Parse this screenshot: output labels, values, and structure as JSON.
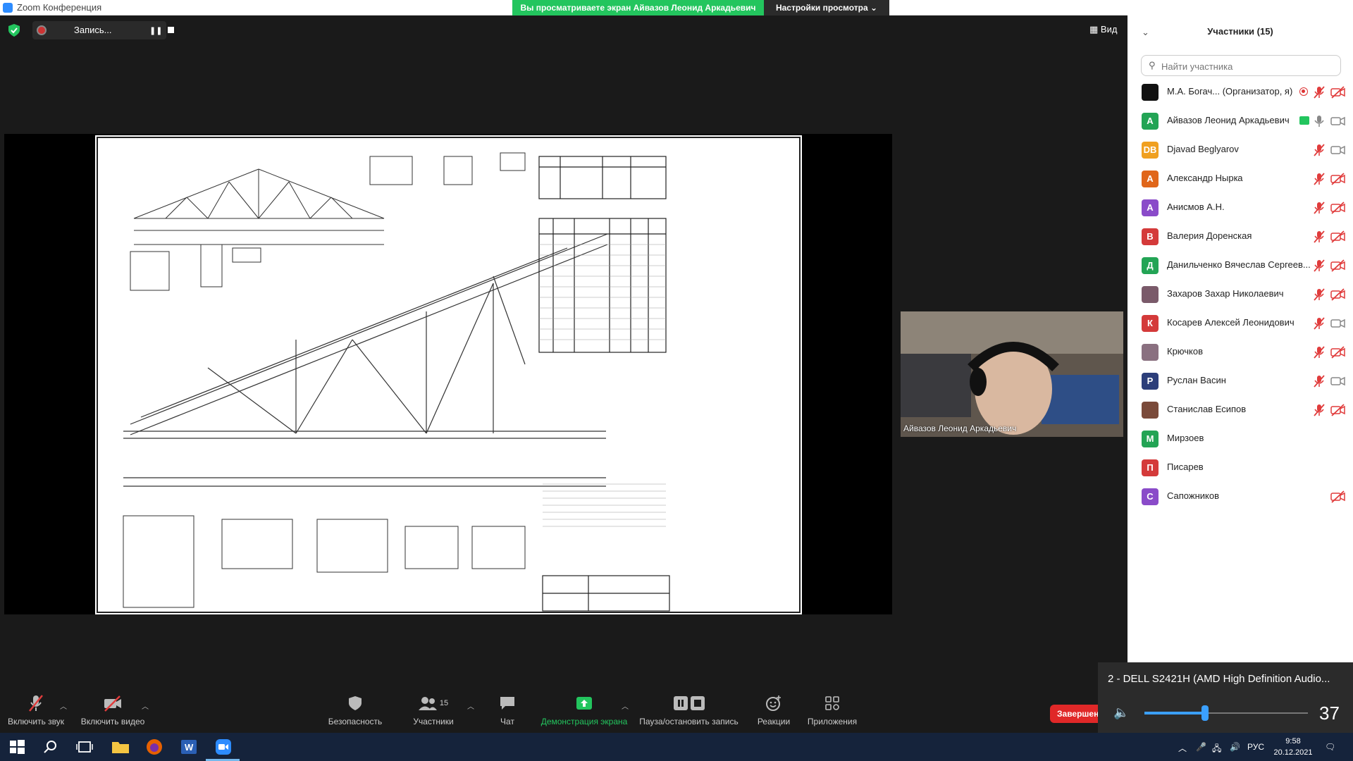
{
  "window": {
    "title": "Zoom Конференция",
    "controls": [
      "—",
      "❐",
      "✕"
    ]
  },
  "share_banner": {
    "text": "Вы просматриваете экран Айвазов Леонид Аркадьевич",
    "view_settings": "Настройки просмотра"
  },
  "top_tools": {
    "recording_label": "Запись...",
    "view_label": "Вид"
  },
  "camera": {
    "name": "Айвазов Леонид Аркадьевич"
  },
  "participants": {
    "title": "Участники (15)",
    "search_placeholder": "Найти участника",
    "list": [
      {
        "initials": "",
        "name": "М.А. Богач... (Организатор, я)",
        "color": "#111111",
        "mic": "muted",
        "video": "off",
        "badge": "recording"
      },
      {
        "initials": "А",
        "name": "Айвазов Леонид Аркадьевич",
        "color": "#23a455",
        "mic": "on",
        "video": "on",
        "badge": "sharing"
      },
      {
        "initials": "DB",
        "name": "Djavad Beglyarov",
        "color": "#f0a020",
        "mic": "muted",
        "video": "on",
        "badge": ""
      },
      {
        "initials": "А",
        "name": "Александр Ныркa",
        "color": "#e0661a",
        "mic": "muted",
        "video": "off",
        "badge": ""
      },
      {
        "initials": "А",
        "name": "Анисмов А.Н.",
        "color": "#8a4bc9",
        "mic": "muted",
        "video": "off",
        "badge": ""
      },
      {
        "initials": "В",
        "name": "Валерия Доренская",
        "color": "#d43a3a",
        "mic": "muted",
        "video": "off",
        "badge": ""
      },
      {
        "initials": "Д",
        "name": "Данильченко Вячеслав Сергеев...",
        "color": "#23a455",
        "mic": "muted",
        "video": "off",
        "badge": ""
      },
      {
        "initials": "",
        "name": "Захаров Захар Николаевич",
        "color": "#7a5a6a",
        "mic": "muted",
        "video": "off",
        "badge": ""
      },
      {
        "initials": "К",
        "name": "Косарев Алексей Леонидович",
        "color": "#d43a3a",
        "mic": "muted",
        "video": "on",
        "badge": ""
      },
      {
        "initials": "",
        "name": "Крючков",
        "color": "#8a7080",
        "mic": "muted",
        "video": "off",
        "badge": ""
      },
      {
        "initials": "Р",
        "name": "Руслан Васин",
        "color": "#2c3e7a",
        "mic": "muted",
        "video": "on",
        "badge": ""
      },
      {
        "initials": "",
        "name": "Станислав Есипов",
        "color": "#7a4a3a",
        "mic": "muted",
        "video": "off",
        "badge": ""
      },
      {
        "initials": "М",
        "name": "Мирзоев",
        "color": "#23a455",
        "mic": "none",
        "video": "none",
        "badge": ""
      },
      {
        "initials": "П",
        "name": "Писарев",
        "color": "#d43a3a",
        "mic": "none",
        "video": "none",
        "badge": ""
      },
      {
        "initials": "С",
        "name": "Сапожников",
        "color": "#8a4bc9",
        "mic": "none",
        "video": "off",
        "badge": ""
      }
    ]
  },
  "toolbar": {
    "unmute": "Включить звук",
    "start_video": "Включить видео",
    "security": "Безопасность",
    "participants": "Участники",
    "participants_count": "15",
    "chat": "Чат",
    "share_screen": "Демонстрация экрана",
    "pause_recording": "Пауза/остановить запись",
    "reactions": "Реакции",
    "apps": "Приложения",
    "end": "Завершен"
  },
  "volume": {
    "device": "2 - DELL S2421H (AMD High Definition Audio...",
    "level": 37
  },
  "taskbar": {
    "lang": "РУС",
    "time": "9:58",
    "date": "20.12.2021"
  },
  "colors": {
    "accent_green": "#23c55e",
    "end_red": "#e02828",
    "muted_red": "#e03c3c",
    "volume_blue": "#3ba0ff"
  }
}
